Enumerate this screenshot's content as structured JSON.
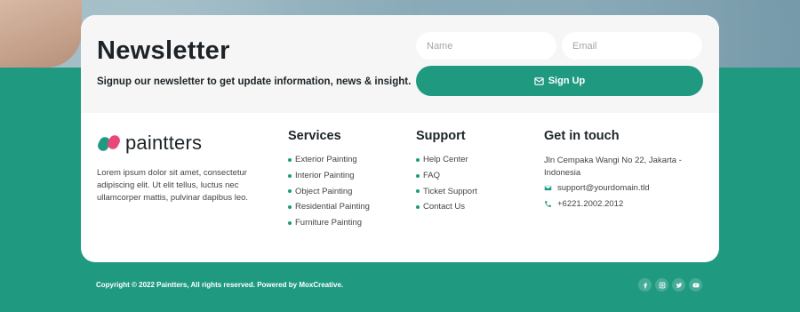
{
  "newsletter": {
    "title": "Newsletter",
    "subtitle": "Signup our newsletter to get update information, news & insight.",
    "name_placeholder": "Name",
    "email_placeholder": "Email",
    "signup_label": "Sign Up"
  },
  "brand": {
    "logo_text": "paintters",
    "description": "Lorem ipsum dolor sit amet, consectetur adipiscing elit. Ut elit tellus, luctus nec ullamcorper mattis, pulvinar dapibus leo."
  },
  "services": {
    "title": "Services",
    "items": [
      "Exterior Painting",
      "Interior Painting",
      "Object Painting",
      "Residential Painting",
      "Furniture Painting"
    ]
  },
  "support": {
    "title": "Support",
    "items": [
      "Help Center",
      "FAQ",
      "Ticket Support",
      "Contact Us"
    ]
  },
  "touch": {
    "title": "Get in touch",
    "address": "Jln Cempaka Wangi No 22, Jakarta - Indonesia",
    "email": "support@yourdomain.tld",
    "phone": "+6221.2002.2012"
  },
  "footer": {
    "copyright": "Copyright © 2022 Paintters, All rights reserved. Powered by MoxCreative."
  },
  "colors": {
    "accent": "#1f9a80",
    "brand_pink": "#e8477a"
  },
  "icons": {
    "signup": "envelope-icon",
    "email": "envelope-icon",
    "phone": "phone-icon",
    "socials": [
      "facebook-icon",
      "instagram-icon",
      "twitter-icon",
      "youtube-icon"
    ]
  }
}
